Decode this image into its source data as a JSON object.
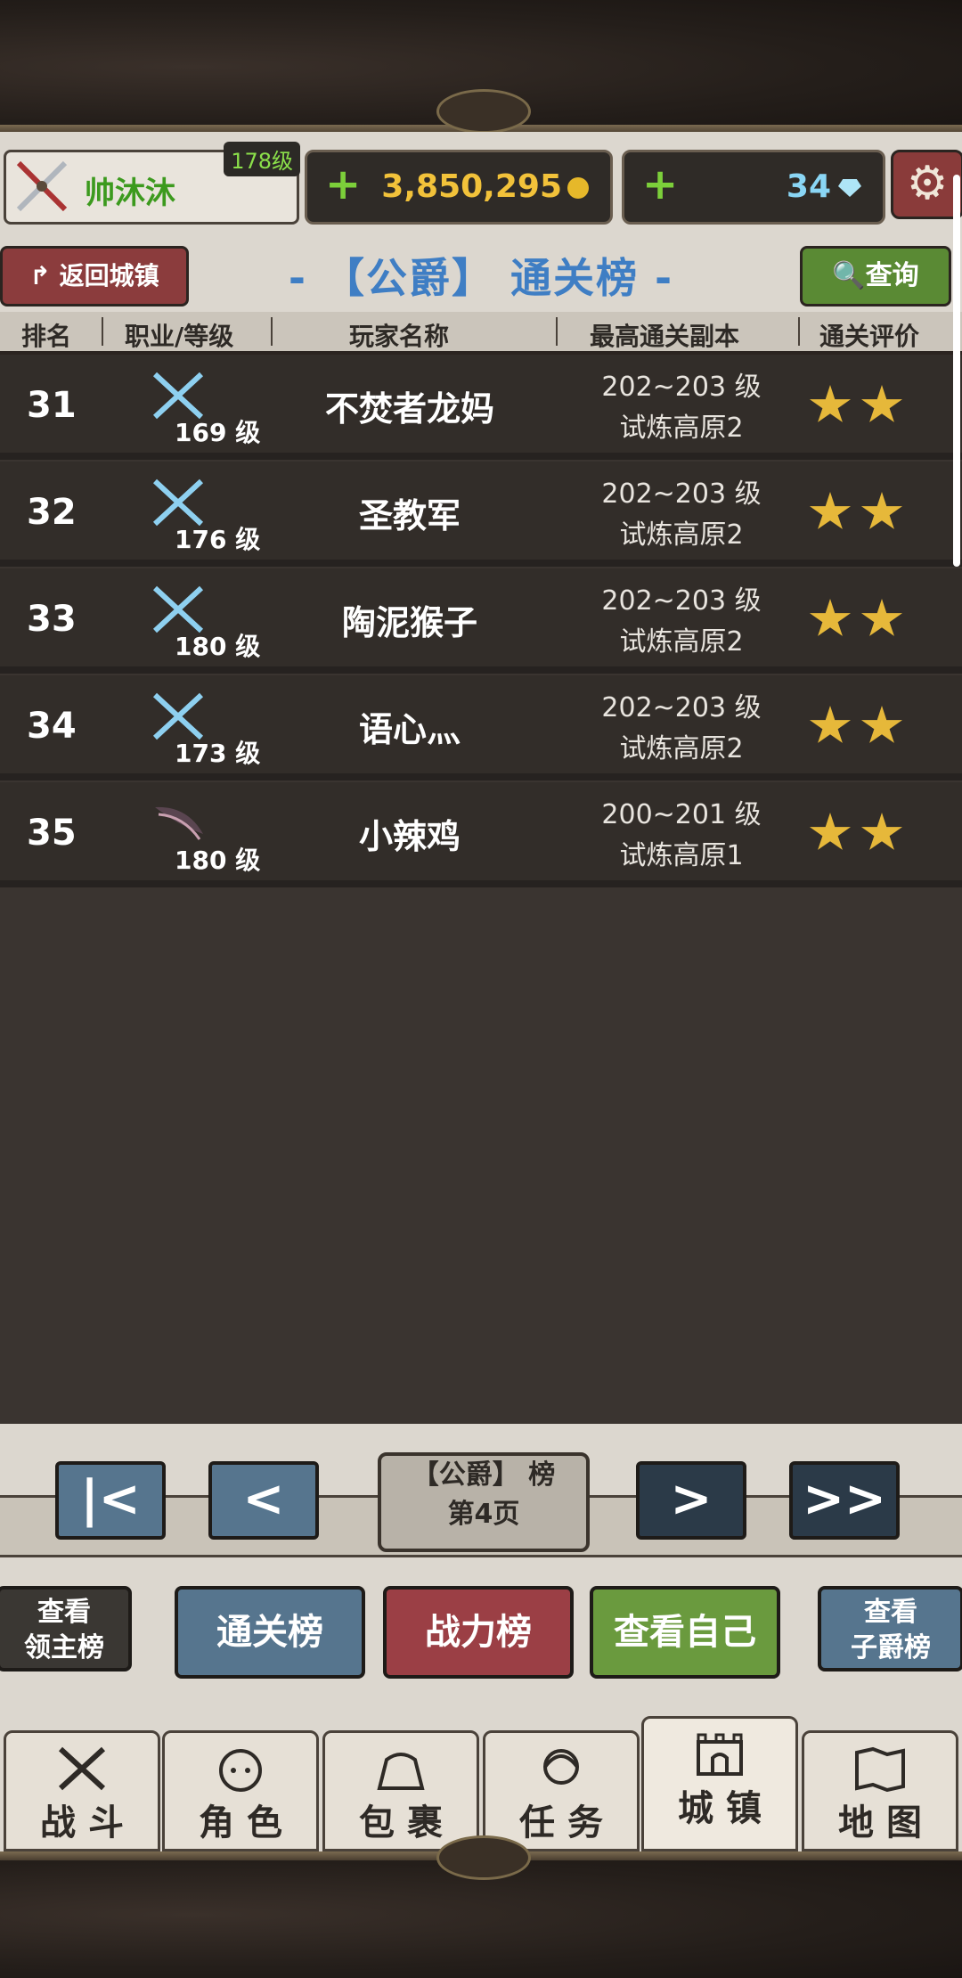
{
  "player": {
    "name": "帅沐沐",
    "level": "178级"
  },
  "resources": {
    "gold": "3,850,295",
    "diamonds": "34",
    "plus": "+"
  },
  "title_bar": {
    "back_label": "返回城镇",
    "title": "- 【公爵】 通关榜 -",
    "query_label": "查询"
  },
  "table": {
    "headers": [
      "排名",
      "职业/等级",
      "玩家名称",
      "最高通关副本",
      "通关评价"
    ],
    "rows": [
      {
        "rank": "31",
        "class_icon": "crossed-swords-icon",
        "level": "169 级",
        "name": "不焚者龙妈",
        "stage_level": "202~203 级",
        "stage_name": "试炼高原2",
        "stars": 2
      },
      {
        "rank": "32",
        "class_icon": "crossed-swords-icon",
        "level": "176 级",
        "name": "圣教军",
        "stage_level": "202~203 级",
        "stage_name": "试炼高原2",
        "stars": 2
      },
      {
        "rank": "33",
        "class_icon": "crossed-swords-icon",
        "level": "180 级",
        "name": "陶泥猴子",
        "stage_level": "202~203 级",
        "stage_name": "试炼高原2",
        "stars": 2
      },
      {
        "rank": "34",
        "class_icon": "crossed-swords-icon",
        "level": "173 级",
        "name": "语心灬",
        "stage_level": "202~203 级",
        "stage_name": "试炼高原2",
        "stars": 2
      },
      {
        "rank": "35",
        "class_icon": "dark-claw-icon",
        "level": "180 级",
        "name": "小辣鸡",
        "stage_level": "200~201 级",
        "stage_name": "试炼高原1",
        "stars": 2
      }
    ]
  },
  "pager": {
    "label_line1": "【公爵】 榜",
    "label_line2": "第4页",
    "first": "|<",
    "prev": "<",
    "next": ">",
    "last": ">>"
  },
  "buttons": {
    "lord_line1": "查看",
    "lord_line2": "领主榜",
    "clear": "通关榜",
    "power": "战力榜",
    "self": "查看自己",
    "viscount_line1": "查看",
    "viscount_line2": "子爵榜"
  },
  "tabs": [
    {
      "label": "战 斗",
      "icon": "crossed-swords-icon"
    },
    {
      "label": "角 色",
      "icon": "character-face-icon"
    },
    {
      "label": "包 裹",
      "icon": "bag-icon"
    },
    {
      "label": "任 务",
      "icon": "quest-girl-icon"
    },
    {
      "label": "城 镇",
      "icon": "castle-gate-icon",
      "active": true
    },
    {
      "label": "地 图",
      "icon": "map-icon"
    }
  ],
  "colors": {
    "title_blue": "#3f7ec4",
    "gold": "#f2c23a",
    "green_level": "#8be04a",
    "star": "#e6b83a"
  }
}
